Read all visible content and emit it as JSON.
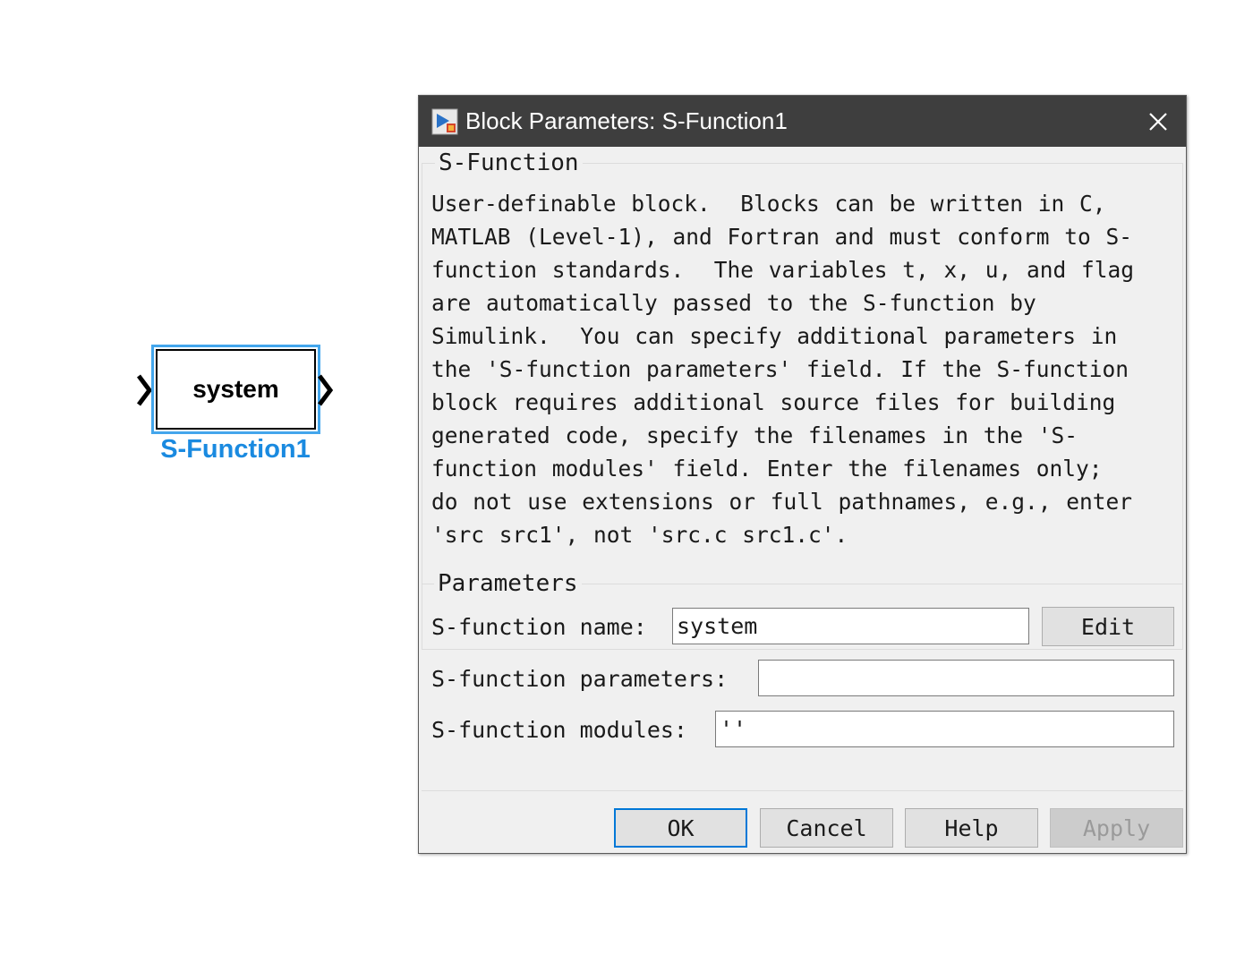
{
  "canvas": {
    "block": {
      "text": "system",
      "label": "S-Function1"
    }
  },
  "dialog": {
    "title": "Block Parameters: S-Function1",
    "icon": "simulink-block-icon",
    "close_icon": "close-icon",
    "description_group": {
      "title": "S-Function",
      "text": "User-definable block.  Blocks can be written in C,\nMATLAB (Level-1), and Fortran and must conform to S-\nfunction standards.  The variables t, x, u, and flag\nare automatically passed to the S-function by\nSimulink.  You can specify additional parameters in\nthe 'S-function parameters' field. If the S-function\nblock requires additional source files for building\ngenerated code, specify the filenames in the 'S-\nfunction modules' field. Enter the filenames only;\ndo not use extensions or full pathnames, e.g., enter\n'src src1', not 'src.c src1.c'."
    },
    "parameters_group": {
      "title": "Parameters",
      "fields": {
        "name": {
          "label": "S-function name:",
          "value": "system"
        },
        "parameters": {
          "label": "S-function parameters:",
          "value": ""
        },
        "modules": {
          "label": "S-function modules:",
          "value": "''"
        }
      },
      "edit_label": "Edit"
    },
    "buttons": {
      "ok": "OK",
      "cancel": "Cancel",
      "help": "Help",
      "apply": "Apply"
    }
  },
  "colors": {
    "titlebar": "#3e3e3e",
    "dialog_bg": "#f0f0f0",
    "block_selection": "#43a6ec",
    "block_label": "#1a8ae0",
    "default_button_border": "#0078d7"
  }
}
